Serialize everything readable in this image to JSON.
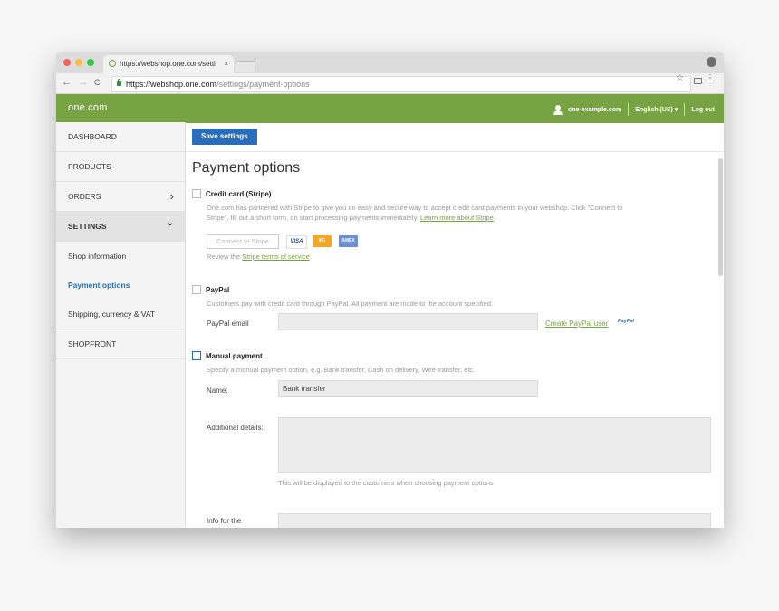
{
  "browser": {
    "tab_title": "https://webshop.one.com/setti",
    "tab_close": "×",
    "url_host": "https://webshop.one.com",
    "url_path": "/settings/payment-options",
    "back": "←",
    "forward": "→",
    "reload": "C",
    "star": "☆",
    "menu": "⋮"
  },
  "header": {
    "logo": "one.com",
    "account": "one-example.com",
    "language": "English (US) ▾",
    "logout": "Log out"
  },
  "sidebar": {
    "items": [
      {
        "label": "DASHBOARD"
      },
      {
        "label": "PRODUCTS"
      },
      {
        "label": "ORDERS",
        "chevron": "›"
      },
      {
        "label": "SETTINGS",
        "chevron": "⌄"
      },
      {
        "label": "Shop information"
      },
      {
        "label": "Payment options"
      },
      {
        "label": "Shipping, currency & VAT"
      },
      {
        "label": "SHOPFRONT"
      }
    ]
  },
  "main": {
    "save_button": "Save settings",
    "page_title": "Payment options",
    "stripe": {
      "title": "Credit card (Stripe)",
      "desc_1": "One.com has partnered with Stripe to give you an easy and secure way to accept credit card payments in your webshop. Click \"Connect to",
      "desc_2": "Stripe\", fill out a short form, an start processing payments immediately.",
      "learn_more": "Learn more about Stripe",
      "connect_button": "Connect to Stripe",
      "card_visa": "VISA",
      "card_mc": "MC",
      "card_amex": "AMEX",
      "terms_prefix": "Review the",
      "terms_link": "Stripe terms of service",
      "terms_suffix": "."
    },
    "paypal": {
      "title": "PayPal",
      "desc": "Customers pay with credit card through PayPal. All payment are made to the account specified.",
      "email_label": "PayPal email",
      "email_value": "",
      "create_link": "Create PayPal user",
      "badge": "PayPal"
    },
    "manual": {
      "title": "Manual payment",
      "desc": "Specify a manual payment option, e.g. Bank transfer, Cash on delivery, Wire transfer, etc.",
      "name_label": "Name:",
      "name_value": "Bank transfer",
      "details_label": "Additional details:",
      "details_value": "",
      "details_hint": "This will be displayed to the customers when choosing payment options",
      "info_label": "Info for the"
    }
  }
}
